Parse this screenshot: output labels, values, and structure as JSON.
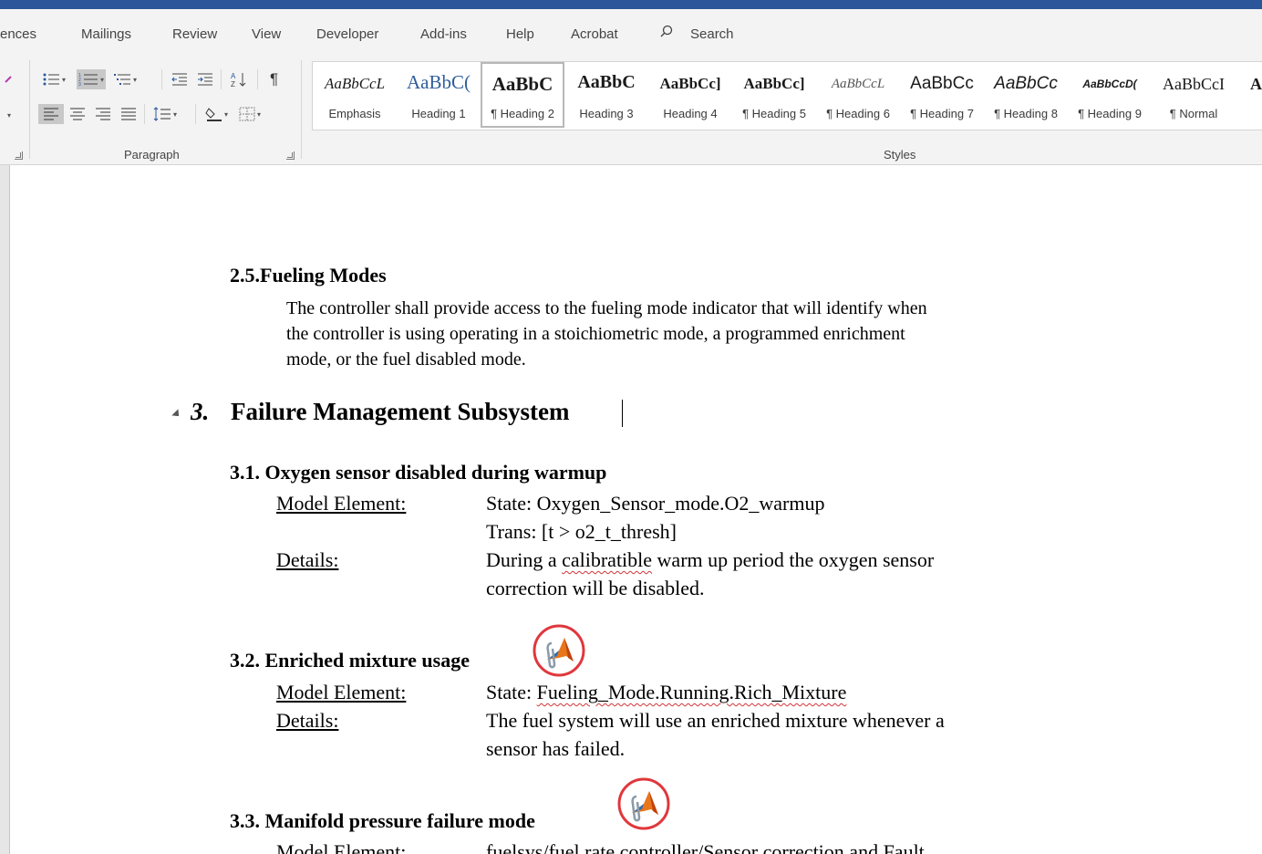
{
  "tabs": [
    "ences",
    "Mailings",
    "Review",
    "View",
    "Developer",
    "Add-ins",
    "Help",
    "Acrobat"
  ],
  "search_label": "Search",
  "ribbon": {
    "paragraph_label": "Paragraph",
    "styles_label": "Styles"
  },
  "styles": [
    {
      "sample": "AaBbCcL",
      "name": "Emphasis"
    },
    {
      "sample": "AaBbC(",
      "name": "Heading 1"
    },
    {
      "sample": "AaBbC",
      "name": "¶ Heading 2",
      "selected": true
    },
    {
      "sample": "AaBbC",
      "name": "Heading 3"
    },
    {
      "sample": "AaBbCc]",
      "name": "Heading 4"
    },
    {
      "sample": "AaBbCc]",
      "name": "¶ Heading 5"
    },
    {
      "sample": "AaBbCcL",
      "name": "¶ Heading 6"
    },
    {
      "sample": "AaBbCc",
      "name": "¶ Heading 7"
    },
    {
      "sample": "AaBbCc",
      "name": "¶ Heading 8"
    },
    {
      "sample": "AaBbCcD(",
      "name": "¶ Heading 9"
    },
    {
      "sample": "AaBbCcI",
      "name": "¶ Normal"
    },
    {
      "sample": "A",
      "name": ""
    }
  ],
  "document": {
    "s25": {
      "number": "2.5.",
      "title": "Fueling Modes",
      "lines": [
        "The controller shall provide access to the fueling mode indicator that will identify when",
        "the controller is using operating in a stoichiometric mode, a programmed enrichment",
        "mode, or the fuel disabled mode."
      ]
    },
    "s3": {
      "number": "3.",
      "title": "Failure Management Subsystem"
    },
    "s31": {
      "number": "3.1.",
      "title": "Oxygen sensor disabled during warmup",
      "model_label": "Model Element:",
      "model_line1": "State: Oxygen_Sensor_mode.O2_warmup",
      "model_line2": "Trans: [t > o2_t_thresh]",
      "details_label": "Details:",
      "details_pre": "During a ",
      "details_squig": "calibratible",
      "details_post": " warm up period the oxygen sensor",
      "details_line2": "correction will be disabled."
    },
    "s32": {
      "number": "3.2.",
      "title": "Enriched mixture usage",
      "model_label": "Model Element:",
      "model_pre": "State: ",
      "model_squig": "Fueling_Mode.Running.Rich_Mixture",
      "details_label": "Details:",
      "details_line1": "The fuel system will use an enriched mixture whenever a",
      "details_line2": "sensor has failed."
    },
    "s33": {
      "number": "3.3.",
      "title": "Manifold pressure failure mode",
      "model_label": "Model Element:",
      "model_line1": "fuelsys/fuel rate controller/Sensor correction and Fault"
    }
  }
}
